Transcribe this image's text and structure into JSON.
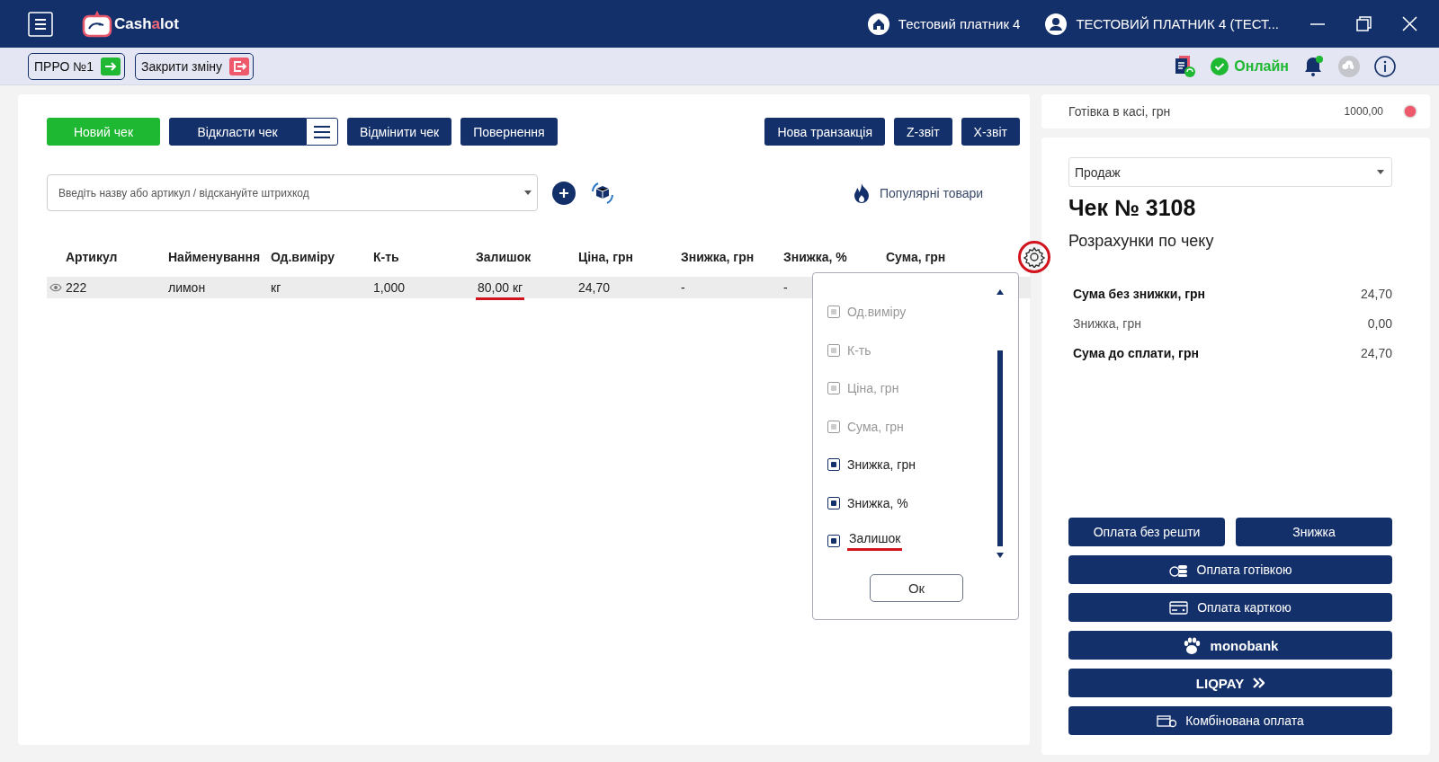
{
  "header": {
    "logo": {
      "before": "Cash",
      "accent": "a",
      "after": "lot"
    },
    "company": "Тестовий платник 4",
    "user": "ТЕСТОВИЙ ПЛАТНИК 4 (ТЕСТ..."
  },
  "toolbar": {
    "buttons": [
      {
        "label": "ПРРО №1",
        "kind": "open"
      },
      {
        "label": "Закрити зміну",
        "kind": "close"
      }
    ],
    "status": "Онлайн",
    "has_notification": true
  },
  "actions": {
    "left": [
      {
        "label": "Новий чек",
        "kind": "success"
      },
      {
        "label": "Відкласти чек",
        "kind": "primary"
      },
      {
        "kind": "menu"
      },
      {
        "label": "Відмінити чек",
        "kind": "primary"
      },
      {
        "label": "Повернення",
        "kind": "primary"
      }
    ],
    "right": [
      {
        "label": "Нова транзакція",
        "kind": "primary"
      },
      {
        "label": "Z-звіт",
        "kind": "primary"
      },
      {
        "label": "X-звіт",
        "kind": "primary"
      }
    ]
  },
  "search": {
    "placeholder": "Введіть назву або артикул / відскануйте штрихкод"
  },
  "popular": "Популярні товари",
  "table": {
    "columns": [
      "Артикул",
      "Найменування",
      "Од.виміру",
      "К-ть",
      "Залишок",
      "Ціна, грн",
      "Знижка, грн",
      "Знижка, %",
      "Сума, грн"
    ],
    "settings_circled": true,
    "rows": [
      {
        "cells": [
          {
            "text": "222",
            "underlined": false
          },
          {
            "text": "лимон",
            "underlined": false
          },
          {
            "text": "кг",
            "underlined": false
          },
          {
            "text": "1,000",
            "underlined": false
          },
          {
            "text": "80,00 кг",
            "underlined": true
          },
          {
            "text": "24,70",
            "underlined": false
          },
          {
            "text": "-",
            "underlined": false
          },
          {
            "text": "-",
            "underlined": false
          }
        ]
      }
    ]
  },
  "column_menu": {
    "options": [
      {
        "label": "Од.виміру",
        "checked": true,
        "disabled": true,
        "underlined": false
      },
      {
        "label": "К-ть",
        "checked": true,
        "disabled": true,
        "underlined": false
      },
      {
        "label": "Ціна, грн",
        "checked": true,
        "disabled": true,
        "underlined": false
      },
      {
        "label": "Сума, грн",
        "checked": true,
        "disabled": true,
        "underlined": false
      },
      {
        "label": "Знижка, грн",
        "checked": true,
        "disabled": false,
        "underlined": false
      },
      {
        "label": "Знижка, %",
        "checked": true,
        "disabled": false,
        "underlined": false
      },
      {
        "label": "Залишок",
        "checked": true,
        "disabled": false,
        "underlined": true
      }
    ],
    "ok": "Ок"
  },
  "cash": {
    "label": "Готівка в касі, грн",
    "value": "1000,00"
  },
  "receipt": {
    "type": "Продаж",
    "title": "Чек № 3108",
    "subtitle": "Розрахунки по чеку",
    "summary": [
      {
        "label": "Сума без знижки, грн",
        "value": "24,70",
        "emphasis": true
      },
      {
        "label": "Знижка, грн",
        "value": "0,00",
        "emphasis": false
      },
      {
        "label": "Сума до сплати, грн",
        "value": "24,70",
        "emphasis": true
      }
    ]
  },
  "payments": [
    {
      "label": "Оплата без решти",
      "kind": "half"
    },
    {
      "label": "Знижка",
      "kind": "half"
    },
    {
      "label": "Оплата готівкою",
      "kind": "cash"
    },
    {
      "label": "Оплата карткою",
      "kind": "card"
    },
    {
      "label": "monobank",
      "kind": "mono"
    },
    {
      "label": "LIQPAY",
      "kind": "liqpay"
    },
    {
      "label": "Комбінована оплата",
      "kind": "combined"
    }
  ]
}
